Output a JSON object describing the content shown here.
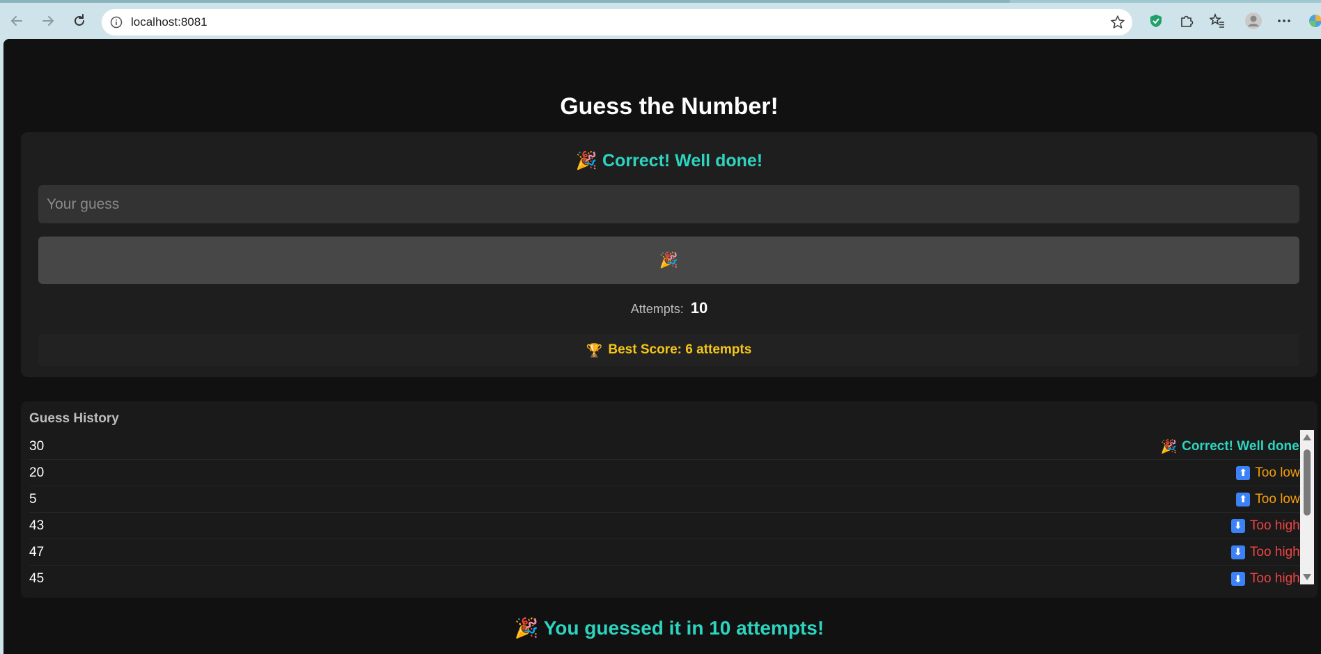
{
  "browser": {
    "url": "localhost:8081"
  },
  "game": {
    "title": "Guess the Number!",
    "status_icon": "🎉",
    "status_text": "Correct! Well done!",
    "input_placeholder": "Your guess",
    "input_value": "",
    "button_icon": "🎉",
    "attempts_label": "Attempts:",
    "attempts_value": "10",
    "best_icon": "🏆",
    "best_score_text": "Best Score: 6 attempts"
  },
  "history": {
    "title": "Guess History",
    "rows": [
      {
        "guess": "30",
        "icon": "🎉",
        "result": "Correct! Well done!",
        "kind": "correct"
      },
      {
        "guess": "20",
        "icon": "⬆",
        "result": "Too low!",
        "kind": "low"
      },
      {
        "guess": "5",
        "icon": "⬆",
        "result": "Too low!",
        "kind": "low"
      },
      {
        "guess": "43",
        "icon": "⬇",
        "result": "Too high!",
        "kind": "high"
      },
      {
        "guess": "47",
        "icon": "⬇",
        "result": "Too high!",
        "kind": "high"
      },
      {
        "guess": "45",
        "icon": "⬇",
        "result": "Too high!",
        "kind": "high"
      }
    ]
  },
  "final_message": {
    "icon": "🎉",
    "text": "You guessed it in 10 attempts!"
  },
  "colors": {
    "accent": "#2dd4bf",
    "low": "#f59e0b",
    "high": "#ef4444",
    "gold": "#f5c518"
  }
}
